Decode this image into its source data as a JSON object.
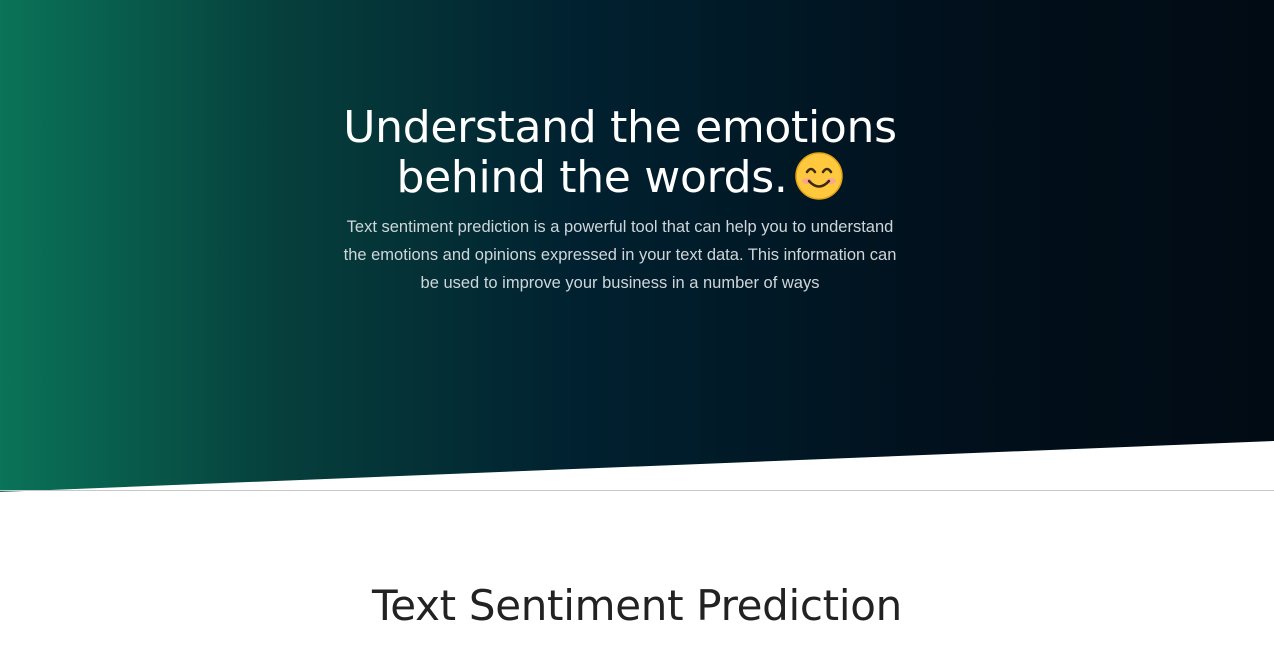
{
  "hero": {
    "title": "Understand the emotions behind the words.",
    "emoji": "smiling-face-icon",
    "description": "Text sentiment prediction is a powerful tool that can help you to understand the emotions and opinions expressed in your text data. This information can be used to improve your business in a number of ways",
    "gradient": [
      "#0a7358",
      "#012130",
      "#010b14"
    ]
  },
  "section": {
    "title": "Text Sentiment Prediction"
  }
}
